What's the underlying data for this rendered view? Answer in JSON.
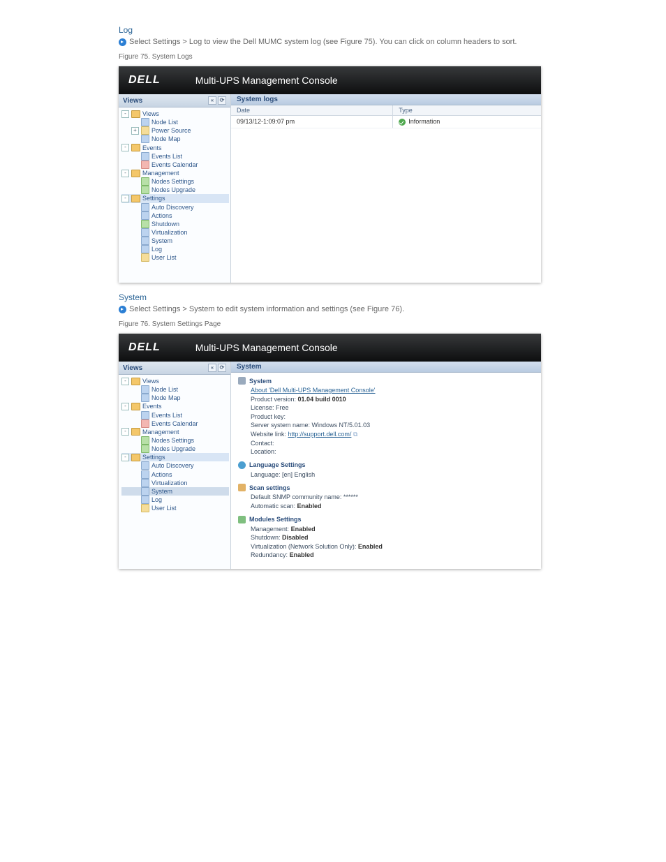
{
  "section1": {
    "heading": "Log",
    "subtext": "Select Settings > Log to view the Dell MUMC system log (see Figure 75). You can click on column headers to sort.",
    "caption": "Figure 75. System Logs"
  },
  "section2": {
    "heading": "System",
    "subtext": "Select Settings > System to edit system information and settings (see Figure 76).",
    "caption": "Figure 76. System Settings Page"
  },
  "console": {
    "logo": "DELL",
    "title": "Multi-UPS Management Console",
    "views_label": "Views",
    "collapse1": "«",
    "collapse2": "⟳"
  },
  "tree1": [
    {
      "d": 0,
      "exp": "-",
      "icon": "folder",
      "label": "Views"
    },
    {
      "d": 1,
      "icon": "b",
      "label": "Node List"
    },
    {
      "d": 1,
      "exp": "+",
      "icon": "y",
      "label": "Power Source"
    },
    {
      "d": 1,
      "icon": "b",
      "label": "Node Map"
    },
    {
      "d": 0,
      "exp": "-",
      "icon": "folder",
      "label": "Events"
    },
    {
      "d": 1,
      "icon": "b",
      "label": "Events List"
    },
    {
      "d": 1,
      "icon": "r",
      "label": "Events Calendar"
    },
    {
      "d": 0,
      "exp": "-",
      "icon": "folder",
      "label": "Management"
    },
    {
      "d": 1,
      "icon": "g",
      "label": "Nodes Settings"
    },
    {
      "d": 1,
      "icon": "g",
      "label": "Nodes Upgrade"
    },
    {
      "d": 0,
      "exp": "-",
      "icon": "folder",
      "label": "Settings",
      "sel": true
    },
    {
      "d": 1,
      "icon": "b",
      "label": "Auto Discovery"
    },
    {
      "d": 1,
      "icon": "b",
      "label": "Actions"
    },
    {
      "d": 1,
      "icon": "g",
      "label": "Shutdown"
    },
    {
      "d": 1,
      "icon": "b",
      "label": "Virtualization"
    },
    {
      "d": 1,
      "icon": "b",
      "label": "System"
    },
    {
      "d": 1,
      "icon": "b",
      "label": "Log"
    },
    {
      "d": 1,
      "icon": "y",
      "label": "User List"
    }
  ],
  "tree2": [
    {
      "d": 0,
      "exp": "-",
      "icon": "folder",
      "label": "Views"
    },
    {
      "d": 1,
      "icon": "b",
      "label": "Node List"
    },
    {
      "d": 1,
      "icon": "b",
      "label": "Node Map"
    },
    {
      "d": 0,
      "exp": "-",
      "icon": "folder",
      "label": "Events"
    },
    {
      "d": 1,
      "icon": "b",
      "label": "Events List"
    },
    {
      "d": 1,
      "icon": "r",
      "label": "Events Calendar"
    },
    {
      "d": 0,
      "exp": "-",
      "icon": "folder",
      "label": "Management"
    },
    {
      "d": 1,
      "icon": "g",
      "label": "Nodes Settings"
    },
    {
      "d": 1,
      "icon": "g",
      "label": "Nodes Upgrade"
    },
    {
      "d": 0,
      "exp": "-",
      "icon": "folder",
      "label": "Settings",
      "sel": true
    },
    {
      "d": 1,
      "icon": "b",
      "label": "Auto Discovery"
    },
    {
      "d": 1,
      "icon": "b",
      "label": "Actions"
    },
    {
      "d": 1,
      "icon": "b",
      "label": "Virtualization"
    },
    {
      "d": 1,
      "icon": "b",
      "label": "System",
      "sel2": true
    },
    {
      "d": 1,
      "icon": "b",
      "label": "Log"
    },
    {
      "d": 1,
      "icon": "y",
      "label": "User List"
    }
  ],
  "logs": {
    "panel_title": "System logs",
    "col_date": "Date",
    "col_type": "Type",
    "rows": [
      {
        "date": "09/13/12-1:09:07 pm",
        "type": "Information"
      }
    ]
  },
  "system": {
    "panel_title": "System",
    "sections": {
      "sys": {
        "title": "System",
        "about": "About 'Dell Multi-UPS Management Console'",
        "version_label": "Product version:",
        "version_value": "01.04 build 0010",
        "license_label": "License:",
        "license_value": "Free",
        "key_label": "Product key:",
        "server_label": "Server system name:",
        "server_value": "Windows NT/5.01.03",
        "link_label": "Website link:",
        "link_value": "http://support.dell.com/",
        "contact_label": "Contact:",
        "location_label": "Location:"
      },
      "lang": {
        "title": "Language Settings",
        "line": "Language: [en] English"
      },
      "scan": {
        "title": "Scan settings",
        "snmp": "Default SNMP community name: ******",
        "auto_label": "Automatic scan:",
        "auto_value": "Enabled"
      },
      "mod": {
        "title": "Modules Settings",
        "mgmt_label": "Management:",
        "mgmt_value": "Enabled",
        "shut_label": "Shutdown:",
        "shut_value": "Disabled",
        "virt_label": "Virtualization (Network Solution Only):",
        "virt_value": "Enabled",
        "red_label": "Redundancy:",
        "red_value": "Enabled"
      }
    }
  }
}
